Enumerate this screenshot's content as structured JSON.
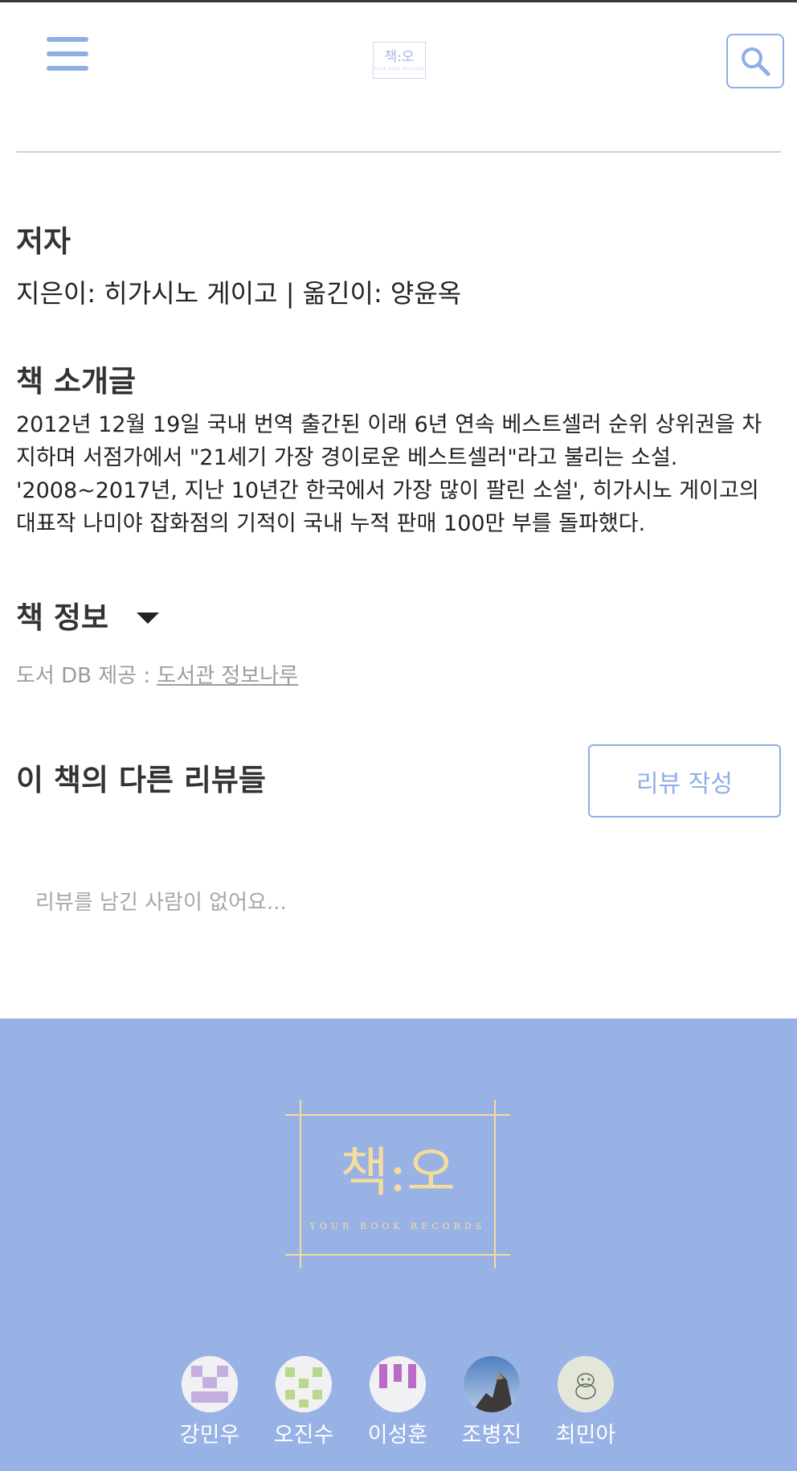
{
  "header": {
    "menu_icon": "hamburger-menu-icon",
    "logo_text": "책:오",
    "logo_subtext": "YOUR BOOK RECORDS",
    "search_icon": "search-icon"
  },
  "author": {
    "heading": "저자",
    "text": "지은이: 히가시노 게이고 | 옮긴이: 양윤옥"
  },
  "intro": {
    "heading": "책 소개글",
    "text": "2012년 12월 19일 국내 번역 출간된 이래 6년 연속 베스트셀러 순위 상위권을 차지하며 서점가에서 \"21세기 가장 경이로운 베스트셀러\"라고 불리는 소설. '2008~2017년, 지난 10년간 한국에서 가장 많이 팔린 소설', 히가시노 게이고의 대표작 나미야 잡화점의 기적이 국내 누적 판매 100만 부를 돌파했다."
  },
  "book_info": {
    "heading": "책 정보",
    "toggle_icon": "caret-down-icon",
    "source_label": "도서 DB 제공 : ",
    "source_link": "도서관 정보나루"
  },
  "reviews": {
    "heading": "이 책의 다른 리뷰들",
    "write_button": "리뷰 작성",
    "empty_message": "리뷰를 남긴 사람이 없어요..."
  },
  "footer": {
    "logo_text": "책:오",
    "logo_subtext": "YOUR BOOK RECORDS",
    "members": [
      {
        "name": "강민우"
      },
      {
        "name": "오진수"
      },
      {
        "name": "이성훈"
      },
      {
        "name": "조병진"
      },
      {
        "name": "최민아"
      }
    ]
  },
  "colors": {
    "accent": "#8faee6",
    "footer_bg": "#98b2e6",
    "logo_gold": "#f6dc9c"
  }
}
